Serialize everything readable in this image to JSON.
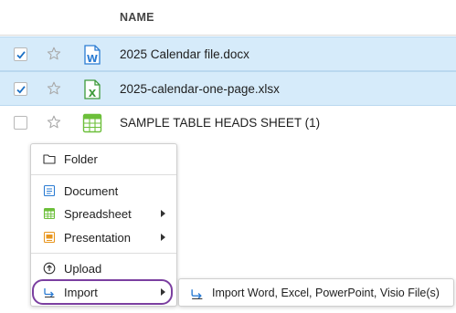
{
  "table": {
    "header": {
      "name_label": "NAME"
    },
    "rows": [
      {
        "name": "2025 Calendar file.docx",
        "selected": true,
        "starred": false,
        "file_type": "word-doc-icon",
        "type_letter": "W"
      },
      {
        "name": "2025-calendar-one-page.xlsx",
        "selected": true,
        "starred": false,
        "file_type": "excel-sheet-icon",
        "type_letter": "X"
      },
      {
        "name": "SAMPLE TABLE HEADS SHEET (1)",
        "selected": false,
        "starred": false,
        "file_type": "smartsheet-grid-icon"
      }
    ]
  },
  "context_menu": {
    "items": [
      {
        "label": "Folder",
        "icon": "folder-icon",
        "has_submenu": false
      },
      {
        "label": "Document",
        "icon": "document-icon",
        "has_submenu": false
      },
      {
        "label": "Spreadsheet",
        "icon": "spreadsheet-icon",
        "has_submenu": true
      },
      {
        "label": "Presentation",
        "icon": "presentation-icon",
        "has_submenu": true
      },
      {
        "label": "Upload",
        "icon": "upload-icon",
        "has_submenu": false
      },
      {
        "label": "Import",
        "icon": "import-icon",
        "has_submenu": true,
        "active": true
      }
    ]
  },
  "import_submenu": {
    "items": [
      {
        "label": "Import Word, Excel, PowerPoint, Visio File(s)",
        "icon": "import-icon"
      }
    ]
  },
  "colors": {
    "selected_row_bg": "#d6ebfa",
    "checkbox_blue": "#1a6fc4",
    "word_blue": "#2b7cd3",
    "excel_green": "#3e9a3a",
    "sheet_green": "#6cbf3a",
    "highlight_purple": "#7b3fa0",
    "presentation_orange": "#e8961e"
  }
}
